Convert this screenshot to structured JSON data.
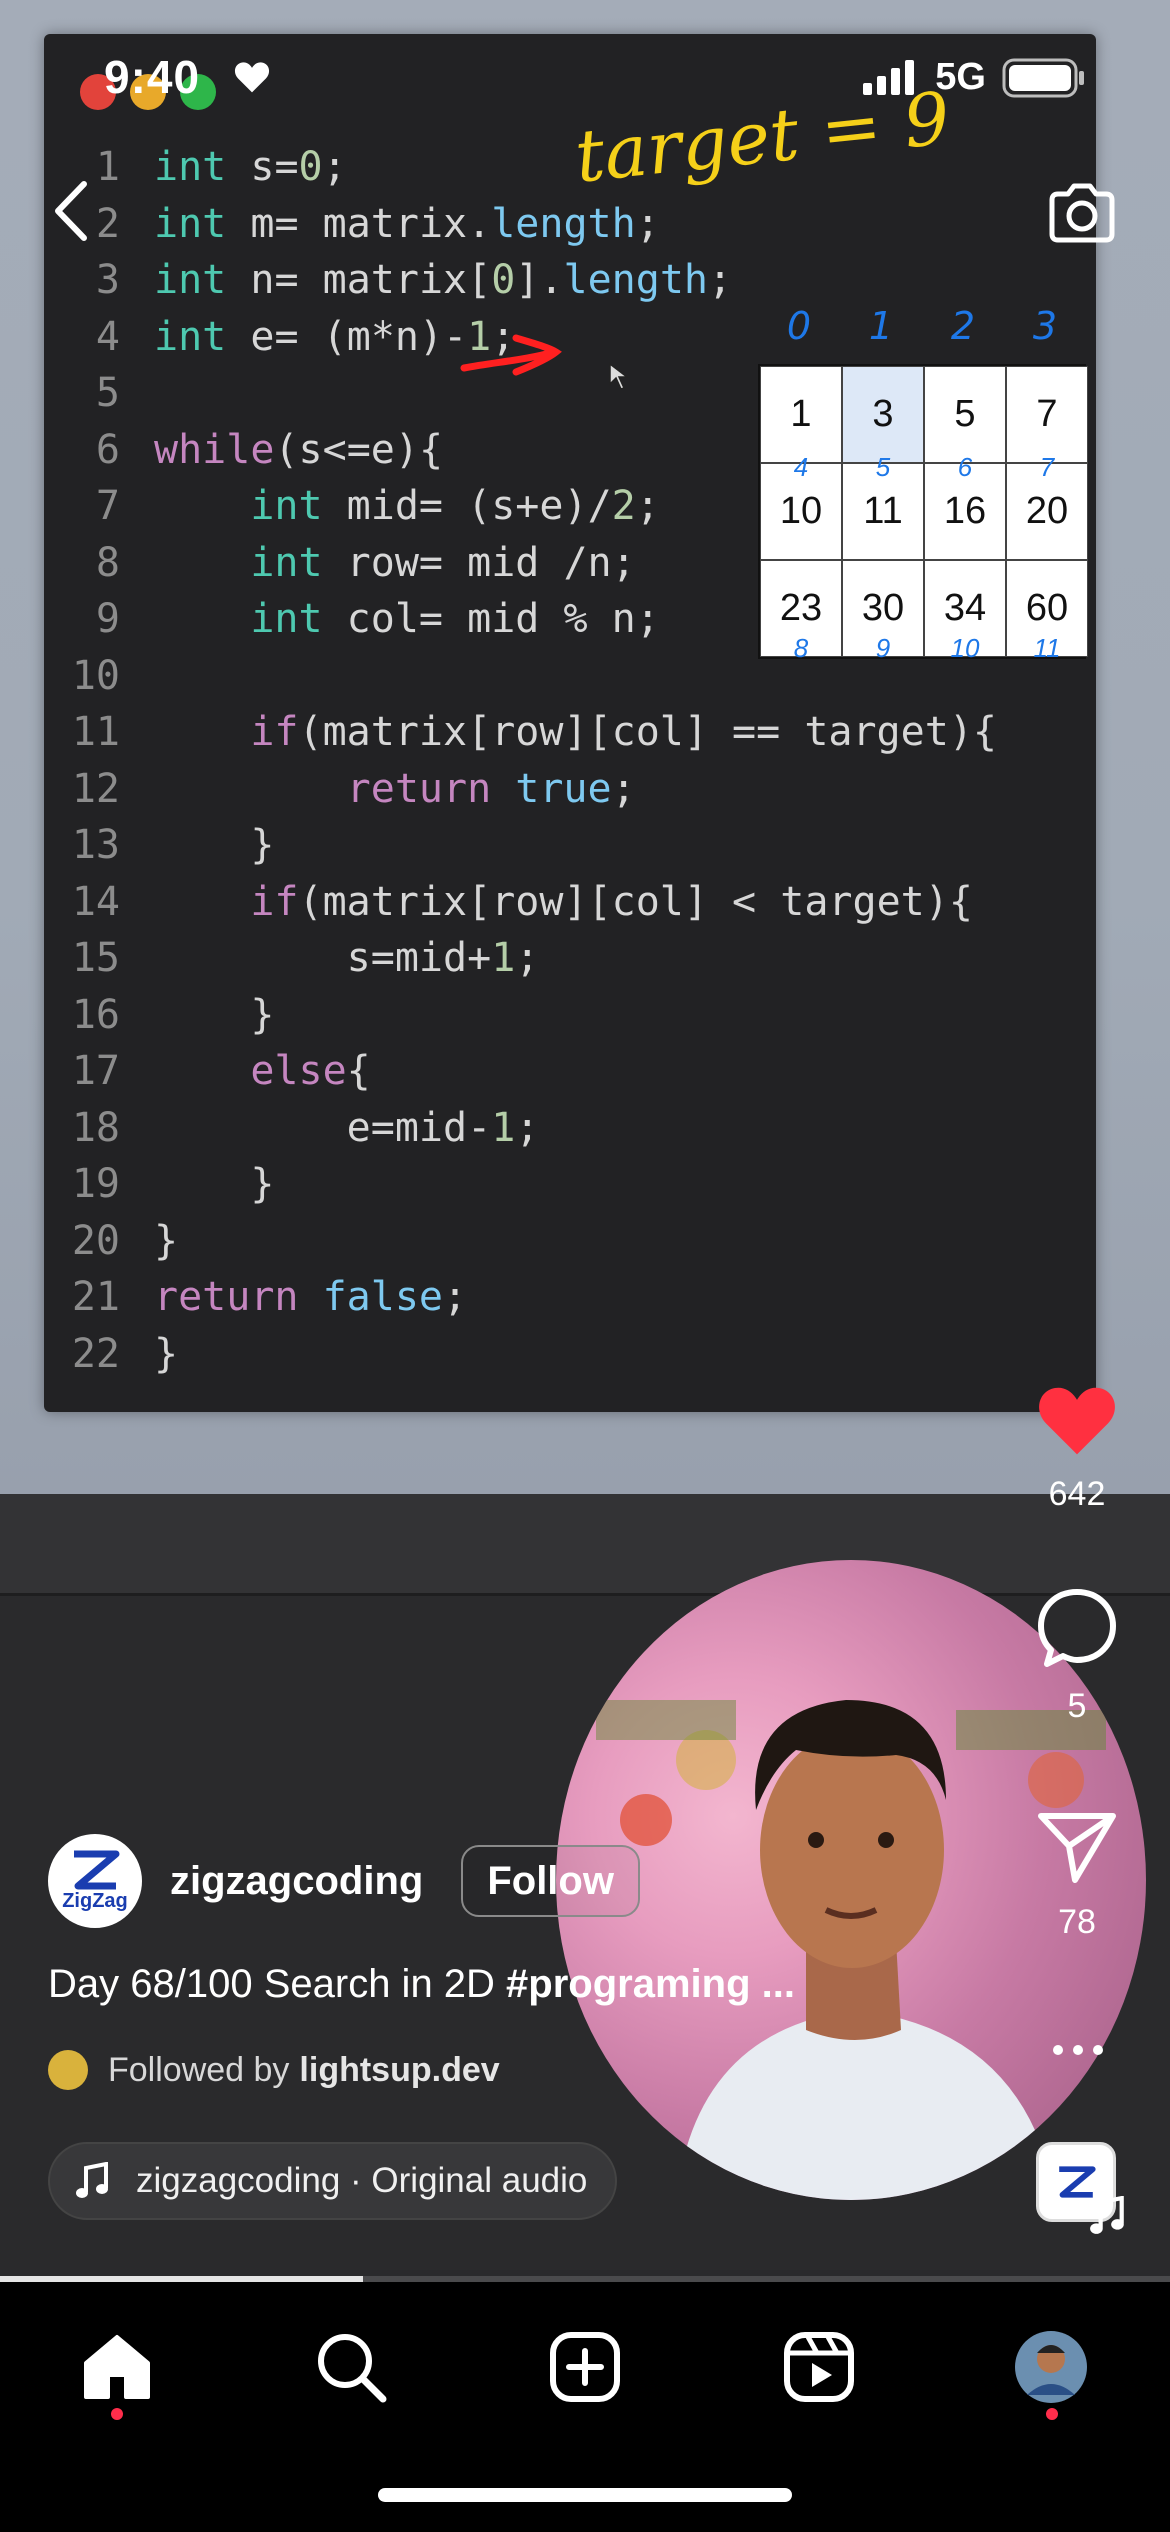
{
  "status_bar": {
    "time": "9:40",
    "network": "5G"
  },
  "annotations": {
    "target": "target = 9"
  },
  "code": {
    "lines": [
      {
        "n": "1",
        "t": "int s=0;"
      },
      {
        "n": "2",
        "t": "int m= matrix.length;"
      },
      {
        "n": "3",
        "t": "int n= matrix[0].length;"
      },
      {
        "n": "4",
        "t": "int e= (m*n)-1;"
      },
      {
        "n": "5",
        "t": ""
      },
      {
        "n": "6",
        "t": "while(s<=e){"
      },
      {
        "n": "7",
        "t": "    int mid= (s+e)/2;"
      },
      {
        "n": "8",
        "t": "    int row= mid /n;"
      },
      {
        "n": "9",
        "t": "    int col= mid % n;"
      },
      {
        "n": "10",
        "t": ""
      },
      {
        "n": "11",
        "t": "    if(matrix[row][col] == target){"
      },
      {
        "n": "12",
        "t": "        return true;"
      },
      {
        "n": "13",
        "t": "    }"
      },
      {
        "n": "14",
        "t": "    if(matrix[row][col] < target){"
      },
      {
        "n": "15",
        "t": "        s=mid+1;"
      },
      {
        "n": "16",
        "t": "    }"
      },
      {
        "n": "17",
        "t": "    else{"
      },
      {
        "n": "18",
        "t": "        e=mid-1;"
      },
      {
        "n": "19",
        "t": "    }"
      },
      {
        "n": "20",
        "t": "}"
      },
      {
        "n": "21",
        "t": "return false;"
      },
      {
        "n": "22",
        "t": "}"
      }
    ]
  },
  "matrix": {
    "col_indices": [
      "0",
      "1",
      "2",
      "3"
    ],
    "cells": [
      {
        "v": "1",
        "i": ""
      },
      {
        "v": "3",
        "i": ""
      },
      {
        "v": "5",
        "i": ""
      },
      {
        "v": "7",
        "i": ""
      },
      {
        "v": "10",
        "i": ""
      },
      {
        "v": "11",
        "i": ""
      },
      {
        "v": "16",
        "i": ""
      },
      {
        "v": "20",
        "i": ""
      },
      {
        "v": "23",
        "i": "8"
      },
      {
        "v": "30",
        "i": "9"
      },
      {
        "v": "34",
        "i": "10"
      },
      {
        "v": "60",
        "i": "11"
      }
    ],
    "row2_top_indices": [
      "4",
      "5",
      "6",
      "7"
    ],
    "highlight_index": 1
  },
  "actions": {
    "likes": "642",
    "comments": "5",
    "shares": "78"
  },
  "post": {
    "username": "zigzagcoding",
    "follow_label": "Follow",
    "caption_text": "Day 68/100 Search in 2D ",
    "caption_tag": "#programing ...",
    "followed_by_prefix": "Followed by",
    "followed_by_user": "lightsup.dev",
    "audio": "zigzagcoding · Original audio",
    "logo_text": "ZigZag"
  },
  "progress": 0.31,
  "colors": {
    "like": "#ff3040",
    "accent_blue": "#1e78e8",
    "notification_dot": "#ff2d4b"
  }
}
